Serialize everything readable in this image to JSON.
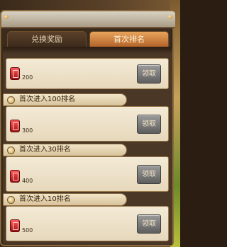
{
  "tabs": [
    {
      "label": "兑换奖励",
      "active": false
    },
    {
      "label": "首次排名",
      "active": true
    }
  ],
  "rewards": [
    {
      "title": "",
      "amount": "200",
      "claim_label": "领取",
      "claimable": false
    },
    {
      "title": "首次进入100排名",
      "amount": "300",
      "claim_label": "领取",
      "claimable": false
    },
    {
      "title": "首次进入30排名",
      "amount": "400",
      "claim_label": "领取",
      "claimable": false
    },
    {
      "title": "首次进入10排名",
      "amount": "500",
      "claim_label": "领取",
      "claimable": false
    }
  ],
  "colors": {
    "active_tab": "#d98a44",
    "panel_border": "#8a6a3e",
    "card": "#efe3c9",
    "button_disabled": "#7d7d7d"
  },
  "icons": {
    "reward": "red-gem-icon",
    "section": "medal-icon"
  }
}
